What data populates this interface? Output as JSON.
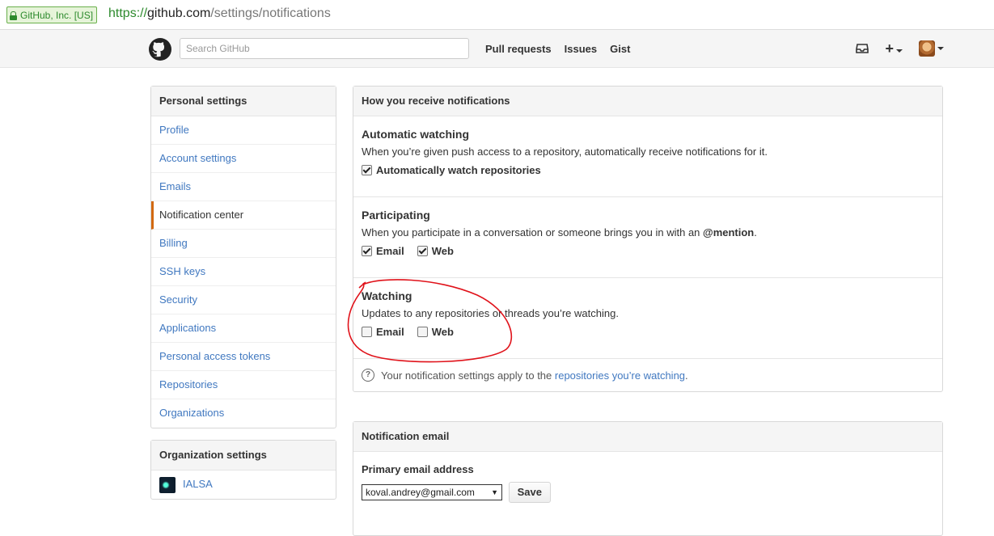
{
  "browser": {
    "ev_label": "GitHub, Inc. [US]",
    "url_scheme": "https://",
    "url_host": "github.com",
    "url_path": "/settings/notifications"
  },
  "header": {
    "search_placeholder": "Search GitHub",
    "nav": [
      "Pull requests",
      "Issues",
      "Gist"
    ],
    "plus_label": "+"
  },
  "sidebar": {
    "personal_heading": "Personal settings",
    "items": [
      {
        "label": "Profile"
      },
      {
        "label": "Account settings"
      },
      {
        "label": "Emails"
      },
      {
        "label": "Notification center",
        "selected": true
      },
      {
        "label": "Billing"
      },
      {
        "label": "SSH keys"
      },
      {
        "label": "Security"
      },
      {
        "label": "Applications"
      },
      {
        "label": "Personal access tokens"
      },
      {
        "label": "Repositories"
      },
      {
        "label": "Organizations"
      }
    ],
    "org_heading": "Organization settings",
    "org_item": "IALSA"
  },
  "notifications": {
    "heading": "How you receive notifications",
    "automatic": {
      "title": "Automatic watching",
      "desc": "When you’re given push access to a repository, automatically receive notifications for it.",
      "checkbox_label": "Automatically watch repositories",
      "checked": true
    },
    "participating": {
      "title": "Participating",
      "desc_prefix": "When you participate in a conversation or someone brings you in with an ",
      "desc_mention": "@mention",
      "desc_suffix": ".",
      "email_label": "Email",
      "web_label": "Web",
      "email_checked": true,
      "web_checked": true
    },
    "watching": {
      "title": "Watching",
      "desc": "Updates to any repositories or threads you’re watching.",
      "email_label": "Email",
      "web_label": "Web",
      "email_checked": false,
      "web_checked": false
    },
    "note_icon": "question-icon",
    "note_prefix": "Your notification settings apply to the ",
    "note_link": "repositories you’re watching",
    "note_suffix": "."
  },
  "email_section": {
    "heading": "Notification email",
    "label": "Primary email address",
    "selected": "koval.andrey@gmail.com",
    "save_label": "Save"
  },
  "colors": {
    "link": "#4078c0",
    "selected_accent": "#d26911",
    "annotation": "#e0121a"
  }
}
